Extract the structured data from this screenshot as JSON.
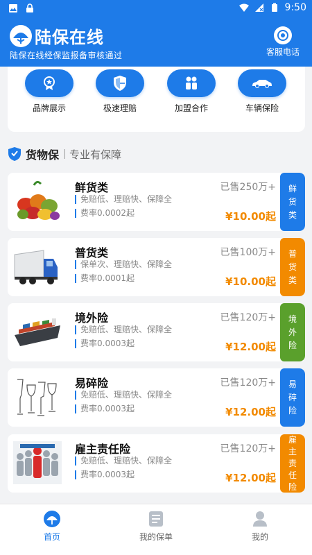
{
  "status_bar": {
    "time": "9:50"
  },
  "header": {
    "title": "陆保在线",
    "subtitle": "陆保在线经保监报备审核通过",
    "customer_service": "客服电话"
  },
  "quick_actions": [
    {
      "label": "品牌展示",
      "icon": "medal-icon"
    },
    {
      "label": "极速理赔",
      "icon": "shield-icon"
    },
    {
      "label": "加盟合作",
      "icon": "people-icon"
    },
    {
      "label": "车辆保险",
      "icon": "car-icon"
    }
  ],
  "section": {
    "title": "货物保",
    "slogan": "专业有保障"
  },
  "products": [
    {
      "name": "鲜货类",
      "features": "免赔低、理赔快、保障全",
      "rate": "费率0.0002起",
      "sold": "已售250万+",
      "price": "¥10.00起",
      "tag": [
        "鲜",
        "货",
        "类"
      ],
      "tag_color": "#1e7be8"
    },
    {
      "name": "普货类",
      "features": "保单次、理赔快、保障全",
      "rate": "费率0.0001起",
      "sold": "已售100万+",
      "price": "¥10.00起",
      "tag": [
        "普",
        "货",
        "类"
      ],
      "tag_color": "#f28a00"
    },
    {
      "name": "境外险",
      "features": "免赔低、理赔快、保障全",
      "rate": "费率0.0003起",
      "sold": "已售120万+",
      "price": "¥12.00起",
      "tag": [
        "境",
        "外",
        "险"
      ],
      "tag_color": "#5aa02c"
    },
    {
      "name": "易碎险",
      "features": "免赔低、理赔快、保障全",
      "rate": "费率0.0003起",
      "sold": "已售120万+",
      "price": "¥12.00起",
      "tag": [
        "易",
        "碎",
        "险"
      ],
      "tag_color": "#1e7be8"
    },
    {
      "name": "雇主责任险",
      "features": "免赔低、理赔快、保障全",
      "rate": "费率0.0003起",
      "sold": "已售120万+",
      "price": "¥12.00起",
      "tag": [
        "雇",
        "主",
        "责",
        "任",
        "险"
      ],
      "tag_color": "#f28a00"
    }
  ],
  "tabbar": [
    {
      "label": "首页",
      "active": true
    },
    {
      "label": "我的保单",
      "active": false
    },
    {
      "label": "我的",
      "active": false
    }
  ],
  "colors": {
    "primary": "#1e7be8",
    "price": "#f28a00",
    "green": "#5aa02c"
  }
}
